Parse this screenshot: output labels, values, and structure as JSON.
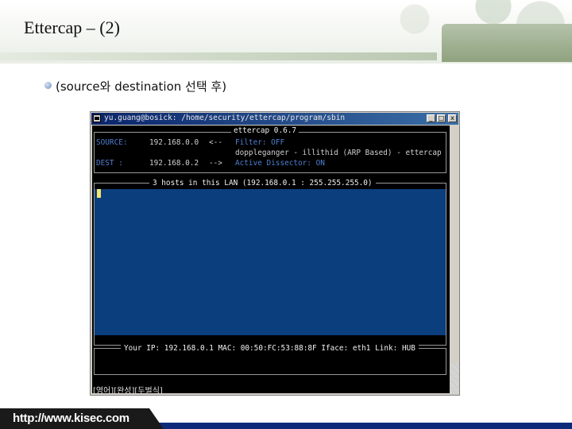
{
  "slide": {
    "title": "Ettercap – (2)",
    "bullet": "(source와 destination 선택 후)",
    "footer_url": "http://www.kisec.com"
  },
  "window": {
    "title": "yu.guang@bosick: /home/security/ettercap/program/sbin",
    "buttons": {
      "minimize": "_",
      "maximize": "□",
      "close": "x"
    }
  },
  "terminal": {
    "app_name": "ettercap 0.6.7",
    "source_label": "SOURCE:",
    "source_value": "192.168.0.0",
    "arrow_1": "<--",
    "dest_label": "DEST  :",
    "dest_value": "192.168.0.2",
    "arrow_2": "-->",
    "filter": "Filter: OFF",
    "doppleganger": "doppleganger - illithid (ARP Based) - ettercap",
    "dissector": "Active Dissector: ON",
    "hosts_title": "3 hosts in this LAN (192.168.0.1 : 255.255.255.0)",
    "status": "Your IP: 192.168.0.1 MAC: 00:50:FC:53:88:8F Iface: eth1 Link: HUB",
    "ime": "[영어][완성][두벌식]"
  },
  "colors": {
    "screen_bg": "#000000",
    "hosts_bg": "#0b3e7d",
    "label_blue": "#4f7fd0",
    "cursor": "#f5e56a",
    "titlebar": "#0a246a",
    "footer": "#0d2a7a"
  }
}
